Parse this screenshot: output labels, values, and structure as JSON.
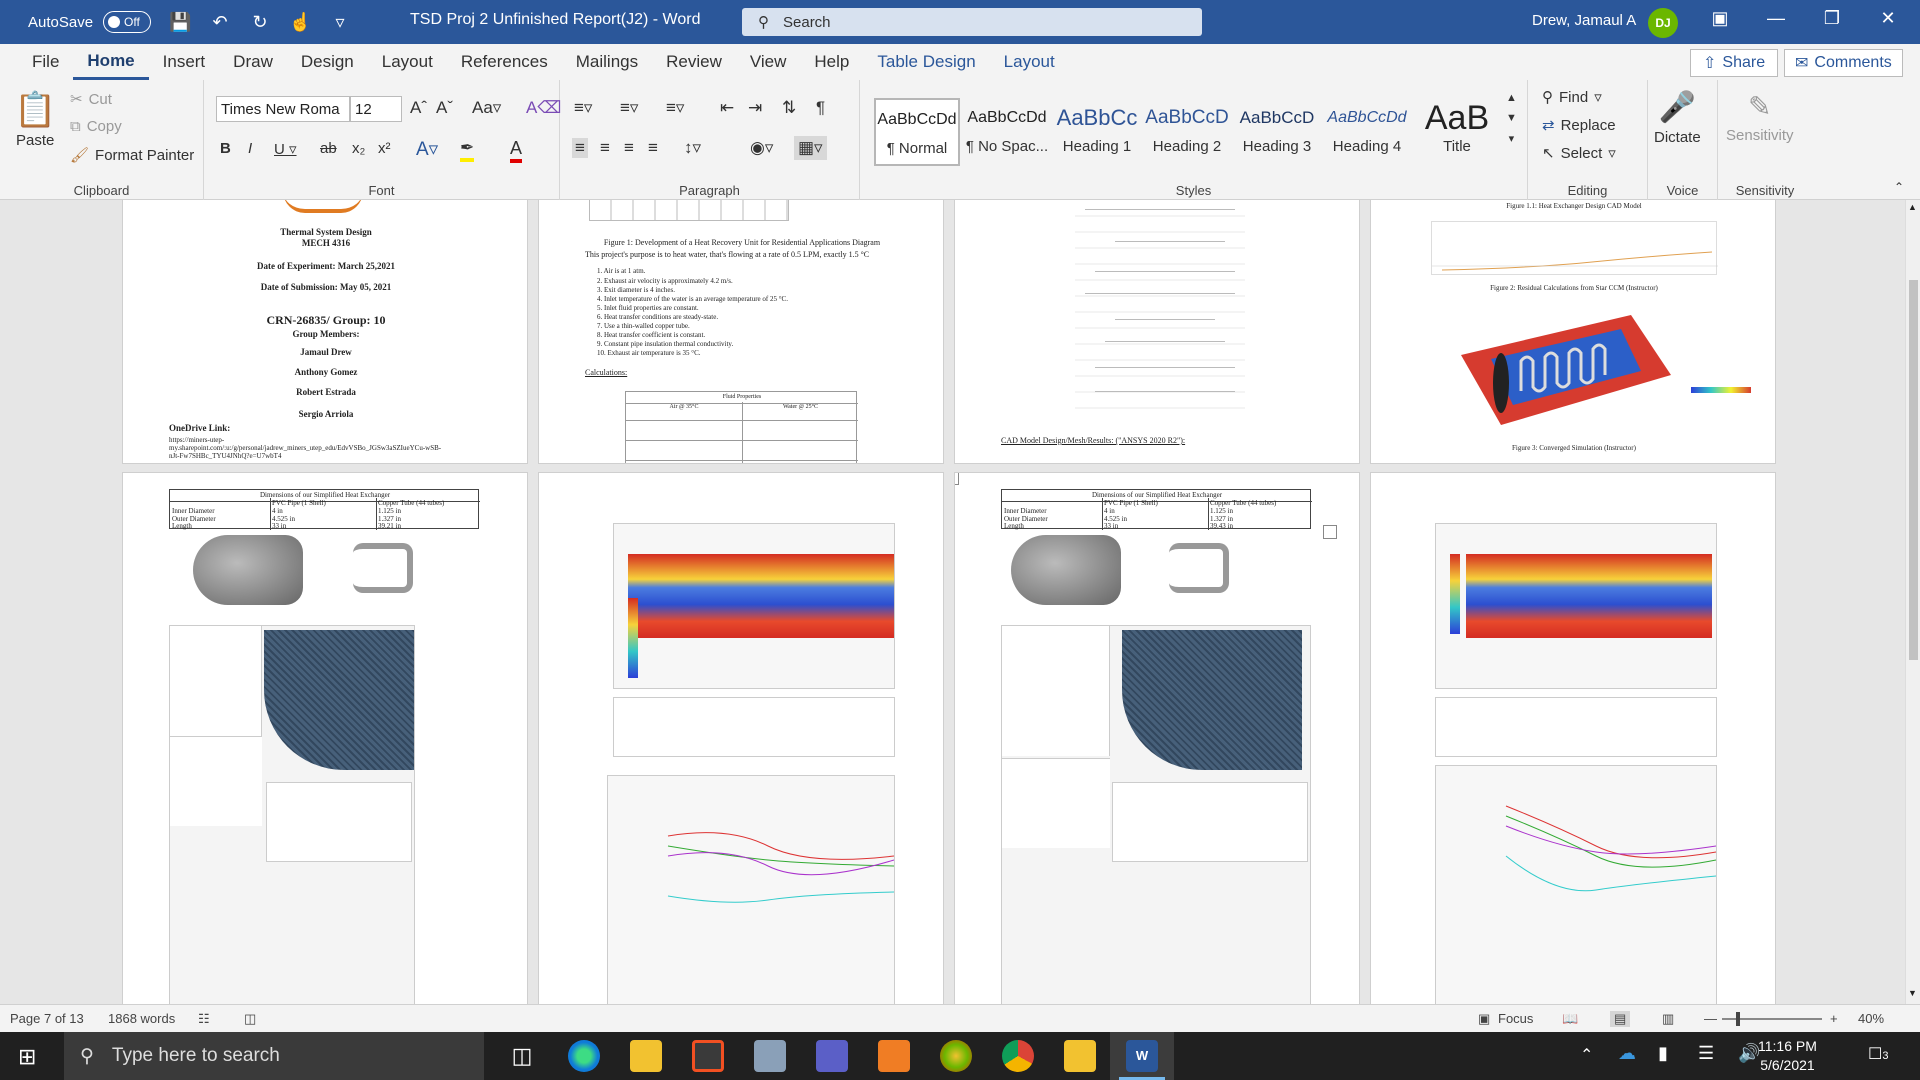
{
  "titlebar": {
    "autosave_label": "AutoSave",
    "autosave_state": "Off",
    "doc_title": "TSD Proj 2 Unfinished Report(J2)  -  Word",
    "search_placeholder": "Search",
    "user_name": "Drew, Jamaul A",
    "user_initials": "DJ"
  },
  "menu": {
    "tabs": [
      "File",
      "Home",
      "Insert",
      "Draw",
      "Design",
      "Layout",
      "References",
      "Mailings",
      "Review",
      "View",
      "Help",
      "Table Design",
      "Layout"
    ],
    "active_tab": "Home",
    "share": "Share",
    "comments": "Comments"
  },
  "ribbon": {
    "clipboard": {
      "paste": "Paste",
      "cut": "Cut",
      "copy": "Copy",
      "format_painter": "Format Painter",
      "label": "Clipboard"
    },
    "font": {
      "font_name": "Times New Roma",
      "font_size": "12",
      "label": "Font"
    },
    "paragraph": {
      "label": "Paragraph"
    },
    "styles": {
      "items": [
        {
          "preview": "AaBbCcDd",
          "name": "¶ Normal"
        },
        {
          "preview": "AaBbCcDd",
          "name": "¶ No Spac..."
        },
        {
          "preview": "AaBbCc",
          "name": "Heading 1"
        },
        {
          "preview": "AaBbCcD",
          "name": "Heading 2"
        },
        {
          "preview": "AaBbCcD",
          "name": "Heading 3"
        },
        {
          "preview": "AaBbCcDd",
          "name": "Heading 4"
        },
        {
          "preview": "AaB",
          "name": "Title"
        }
      ],
      "label": "Styles"
    },
    "editing": {
      "find": "Find",
      "replace": "Replace",
      "select": "Select",
      "label": "Editing"
    },
    "voice": {
      "dictate": "Dictate",
      "label": "Voice"
    },
    "sensitivity": {
      "button": "Sensitivity",
      "label": "Sensitivity"
    }
  },
  "pages": {
    "p1": {
      "course": "Thermal System Design",
      "code": "MECH 4316",
      "date_exp": "Date of Experiment: March 25,2021",
      "date_sub": "Date of Submission: May 05, 2021",
      "crn": "CRN-26835/ Group: 10",
      "members_label": "Group Members:",
      "members": [
        "Jamaul Drew",
        "Anthony Gomez",
        "Robert Estrada",
        "Sergio Arriola"
      ],
      "onedrive": "OneDrive Link:",
      "link1": "https://miners-utep-",
      "link2": "my.sharepoint.com/:u:/g/personal/jadrew_miners_utep_edu/EdvVSBo_JGSw3aSZIueYCu-wSB-",
      "link3": "nJt-Fw7SHBc_TYU4JNhQ?e=U7wbT4"
    },
    "p2": {
      "caption": "Figure 1: Development of a Heat Recovery Unit for Residential Applications Diagram",
      "intro": "This project's purpose is to heat water, that's flowing at a rate of 0.5 LPM, exactly 1.5 °C",
      "assumptions": [
        "1.  Air is at 1 atm.",
        "2.  Exhaust air velocity is approximately 4.2 m/s.",
        "3.  Exit diameter is 4 inches.",
        "4.  Inlet temperature of the water is an average temperature of 25 °C.",
        "5.  Inlet fluid properties are constant.",
        "6.  Heat transfer conditions are steady-state.",
        "7.  Use a thin-walled copper tube.",
        "8.  Heat transfer coefficient is constant.",
        "9.  Constant pipe insulation thermal conductivity.",
        "10. Exhaust air temperature is 35 °C."
      ],
      "calc_label": "Calculations:",
      "table_title": "Fluid Properties",
      "table_head": [
        "Air @ 35°C",
        "Water @ 25°C"
      ]
    },
    "p3": {
      "link": "CAD Model Design/Mesh/Results: (\"ANSYS 2020 R2\"):"
    },
    "p4": {
      "caption_top": "Figure 1.1:  Heat Exchanger Design CAD Model",
      "caption2": "Figure 2: Residual Calculations from Star CCM (Instructor)",
      "caption3": "Figure 3: Converged Simulation (Instructor)"
    },
    "p5": {
      "table_title": "Dimensions of our Simplified Heat Exchanger",
      "head": [
        "",
        "PVC Pipe (1 Shell)",
        "Copper Tube (44 tubes)"
      ],
      "rows": [
        [
          "Inner Diameter",
          "4 in",
          "1.125 in"
        ],
        [
          "Outer Diameter",
          "4.525 in",
          "1.327 in"
        ],
        [
          "Length",
          "33 in",
          "39.21 in"
        ]
      ]
    },
    "p7": {
      "table_title": "Dimensions of our Simplified Heat Exchanger",
      "head": [
        "",
        "PVC Pipe (1 Shell)",
        "Copper Tube (44 tubes)"
      ],
      "rows": [
        [
          "Inner Diameter",
          "4 in",
          "1.125 in"
        ],
        [
          "Outer Diameter",
          "4.525 in",
          "1.327 in"
        ],
        [
          "Length",
          "33 in",
          "39.43 in"
        ]
      ]
    }
  },
  "status": {
    "page": "Page 7 of 13",
    "words": "1868 words",
    "focus": "Focus",
    "zoom": "40%"
  },
  "taskbar": {
    "search_placeholder": "Type here to search",
    "time": "11:16 PM",
    "date": "5/6/2021",
    "notifications": "3"
  }
}
